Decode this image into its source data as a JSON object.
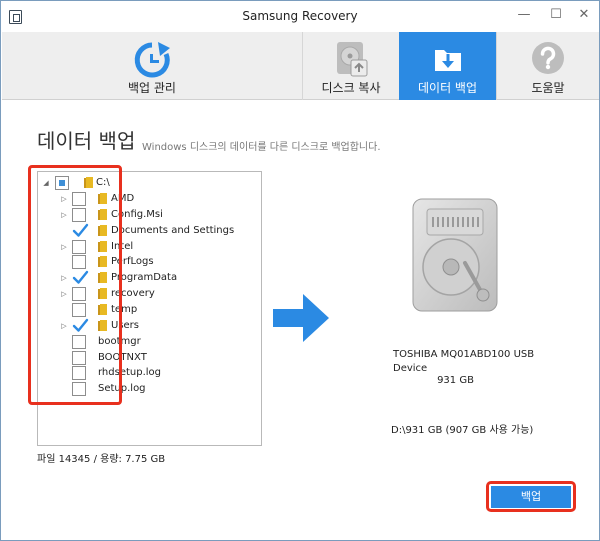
{
  "window": {
    "title": "Samsung Recovery",
    "controls": [
      "minimize",
      "maximize",
      "close"
    ]
  },
  "tabs": [
    {
      "label": "백업 관리",
      "icon": "backup-refresh-icon",
      "active": false
    },
    {
      "label": "디스크 복사",
      "icon": "disk-copy-icon",
      "active": false
    },
    {
      "label": "데이터 백업",
      "icon": "data-backup-download-icon",
      "active": true
    },
    {
      "label": "도움말",
      "icon": "help-question-icon",
      "active": false
    }
  ],
  "page": {
    "title": "데이터 백업",
    "subtitle": "Windows 디스크의 데이터를 다른 디스크로 백업합니다."
  },
  "tree": {
    "root": {
      "label": "C:\\",
      "expanded": true,
      "state": "partial"
    },
    "items": [
      {
        "label": "AMD",
        "expandable": true,
        "folder": true,
        "checked": false
      },
      {
        "label": "Config.Msi",
        "expandable": true,
        "folder": true,
        "checked": false
      },
      {
        "label": "Documents and Settings",
        "expandable": false,
        "folder": true,
        "checked": true
      },
      {
        "label": "Intel",
        "expandable": true,
        "folder": true,
        "checked": false
      },
      {
        "label": "PerfLogs",
        "expandable": false,
        "folder": true,
        "checked": false
      },
      {
        "label": "ProgramData",
        "expandable": true,
        "folder": true,
        "checked": true
      },
      {
        "label": "recovery",
        "expandable": true,
        "folder": true,
        "checked": false
      },
      {
        "label": "temp",
        "expandable": false,
        "folder": true,
        "checked": false
      },
      {
        "label": "Users",
        "expandable": true,
        "folder": true,
        "checked": true
      },
      {
        "label": "bootmgr",
        "expandable": false,
        "folder": false,
        "checked": false
      },
      {
        "label": "BOOTNXT",
        "expandable": false,
        "folder": false,
        "checked": false
      },
      {
        "label": "rhdsetup.log",
        "expandable": false,
        "folder": false,
        "checked": false
      },
      {
        "label": "Setup.log",
        "expandable": false,
        "folder": false,
        "checked": false
      }
    ]
  },
  "file_info": "파일 14345 / 용량: 7.75 GB",
  "target": {
    "name": "TOSHIBA MQ01ABD100 USB Device",
    "size": "931 GB",
    "space": "D:\\931 GB (907 GB 사용 가능)"
  },
  "backup_button": "백업",
  "colors": {
    "accent": "#2b8ae3",
    "highlight": "#e8301e",
    "tab_bg": "#eeeeee",
    "folder": "#e8b923"
  }
}
